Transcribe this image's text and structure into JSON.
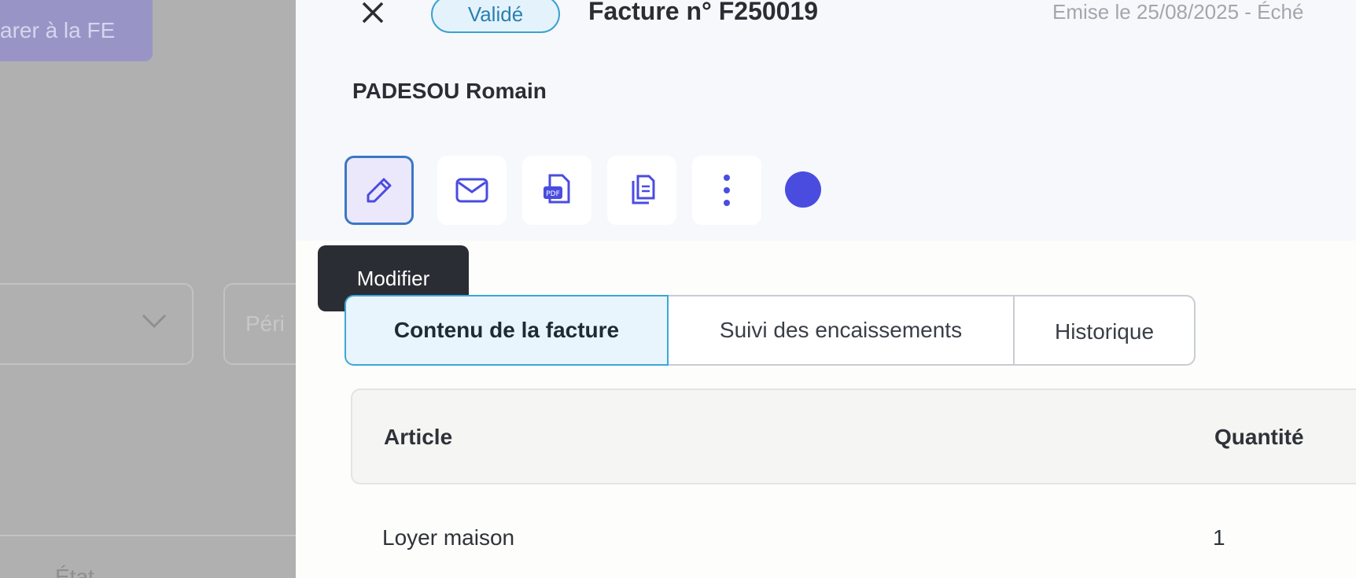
{
  "background": {
    "button_label": "arer à la FE",
    "period_placeholder": "Péri",
    "state_label": "État"
  },
  "drawer": {
    "status": "Validé",
    "title": "Facture n° F250019",
    "issue_info": "Emise le 25/08/2025 - Éché",
    "client": "PADESOU Romain",
    "actions": [
      {
        "name": "edit",
        "icon": "pencil-icon"
      },
      {
        "name": "email",
        "icon": "envelope-icon"
      },
      {
        "name": "pdf",
        "icon": "pdf-icon"
      },
      {
        "name": "duplicate",
        "icon": "copy-icon"
      },
      {
        "name": "more",
        "icon": "more-vertical-icon"
      }
    ],
    "tooltip": "Modifier",
    "tabs": [
      "Contenu de la facture",
      "Suivi des encaissements",
      "Historique"
    ],
    "table": {
      "columns": [
        "Article",
        "Quantité"
      ],
      "rows": [
        {
          "article": "Loyer maison",
          "quantity": "1"
        }
      ]
    }
  },
  "colors": {
    "accent": "#4a4ce0",
    "status_badge": "#3da0d0",
    "tooltip_bg": "#2a2d33"
  }
}
